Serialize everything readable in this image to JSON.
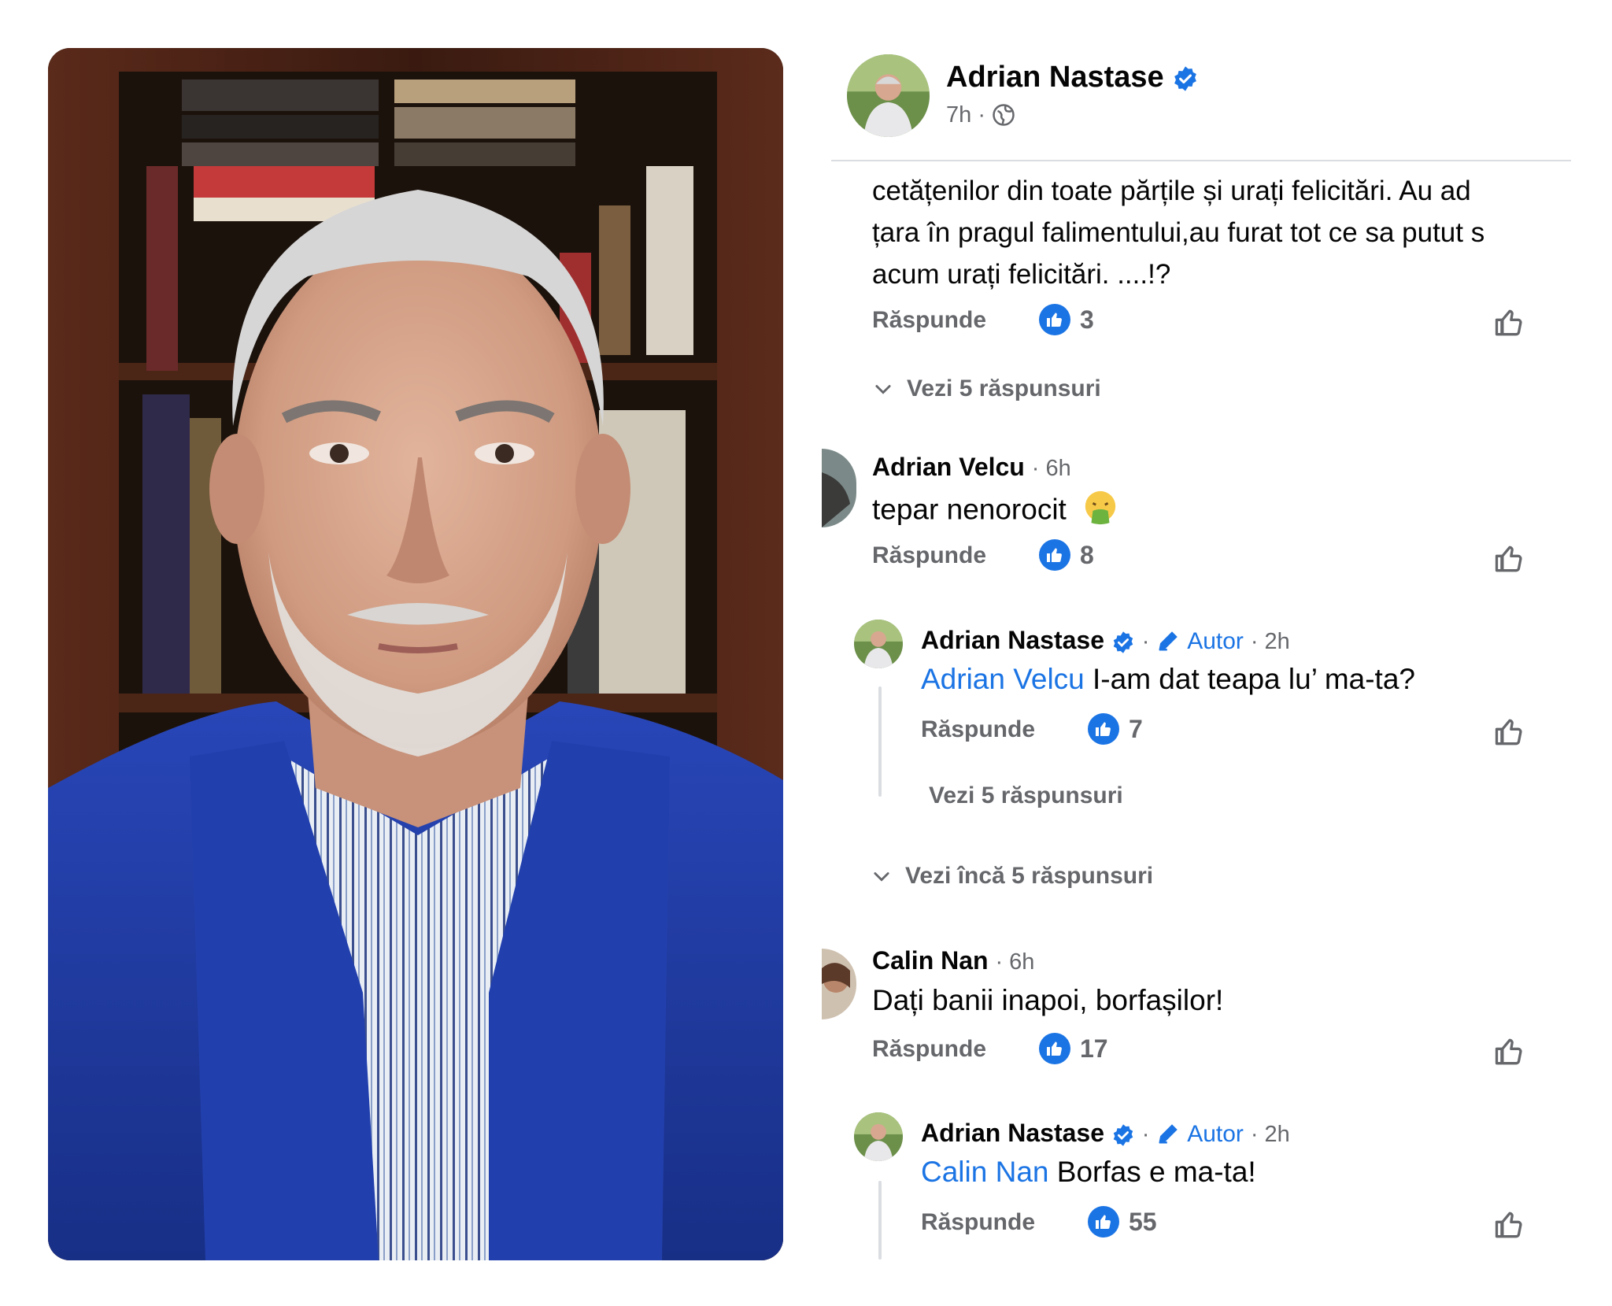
{
  "post": {
    "author": "Adrian Nastase",
    "time": "7h",
    "separator": "·"
  },
  "comments": [
    {
      "text_lines": [
        "cetățenilor din toate părțile și urați felicitări. Au ad",
        "țara în pragul falimentului,au furat tot ce sa putut s",
        "acum urați felicitări. ....!?"
      ],
      "reply_label": "Răspunde",
      "likes": "3",
      "view_replies": "Vezi 5 răspunsuri"
    },
    {
      "name": "Adrian Velcu",
      "time": "· 6h",
      "text": "tepar nenorocit",
      "emoji": "🤮",
      "reply_label": "Răspunde",
      "likes": "8",
      "reply": {
        "name": "Adrian Nastase",
        "badge": "Autor",
        "time": "· 2h",
        "dot": "·",
        "mention": "Adrian Velcu",
        "text": " I-am dat teapa lu’ ma-ta?",
        "reply_label": "Răspunde",
        "likes": "7",
        "view_replies": "Vezi 5 răspunsuri"
      },
      "view_more": "Vezi încă 5 răspunsuri"
    },
    {
      "name": "Calin Nan",
      "time": "· 6h",
      "text": "Dați banii inapoi, borfașilor!",
      "reply_label": "Răspunde",
      "likes": "17",
      "reply": {
        "name": "Adrian Nastase",
        "badge": "Autor",
        "time": "· 2h",
        "dot": "·",
        "mention": "Calin Nan",
        "text": " Borfas e ma-ta!",
        "reply_label": "Răspunde",
        "likes": "55"
      }
    }
  ],
  "colors": {
    "accent": "#1b74e4",
    "secondary_text": "#65676b",
    "jacket": "#1f3fa6"
  }
}
